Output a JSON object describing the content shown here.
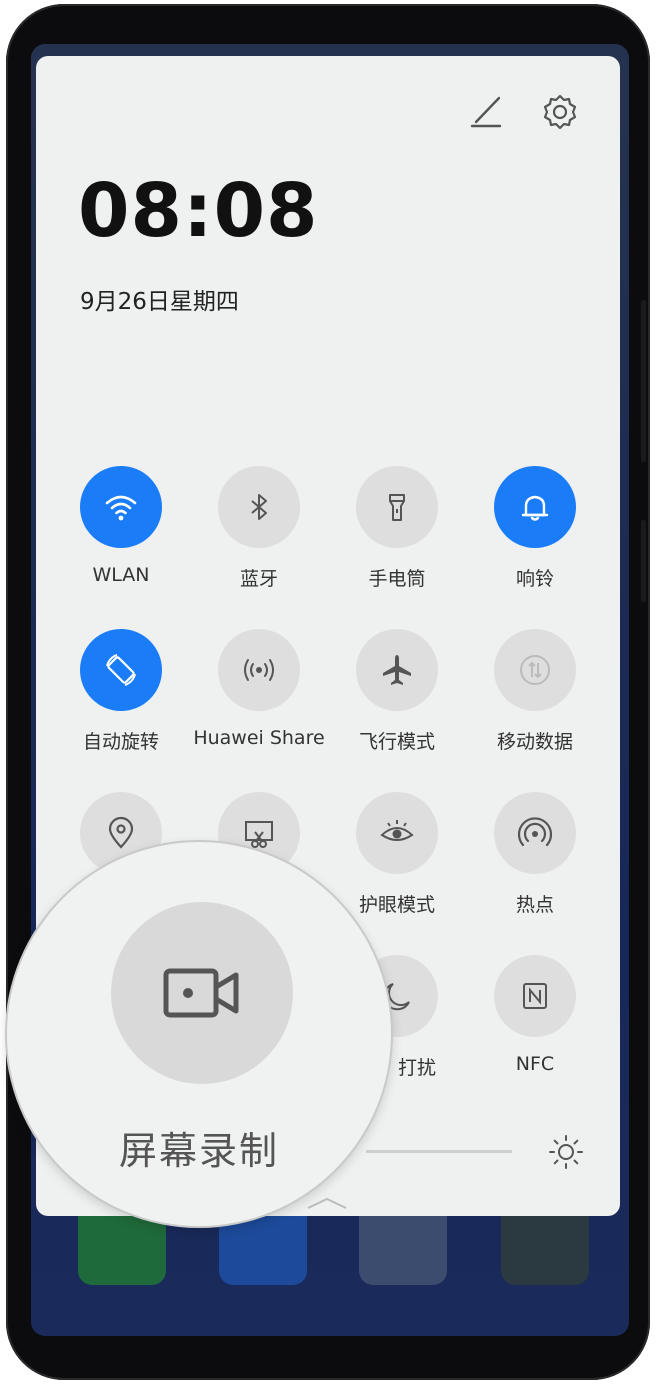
{
  "status": {
    "time": "08:08",
    "date": "9月26日星期四"
  },
  "header_icons": [
    "edit-icon",
    "settings-icon"
  ],
  "tiles": [
    {
      "label": "WLAN",
      "icon": "wifi-icon",
      "active": true
    },
    {
      "label": "蓝牙",
      "icon": "bluetooth-icon",
      "active": false
    },
    {
      "label": "手电筒",
      "icon": "flashlight-icon",
      "active": false
    },
    {
      "label": "响铃",
      "icon": "bell-icon",
      "active": true
    },
    {
      "label": "自动旋转",
      "icon": "auto-rotate-icon",
      "active": true
    },
    {
      "label": "Huawei Share",
      "icon": "huawei-share-icon",
      "active": false
    },
    {
      "label": "飞行模式",
      "icon": "airplane-icon",
      "active": false
    },
    {
      "label": "移动数据",
      "icon": "mobile-data-icon",
      "active": false
    },
    {
      "label": "",
      "icon": "location-icon",
      "active": false
    },
    {
      "label": "",
      "icon": "screenshot-icon",
      "active": false
    },
    {
      "label": "护眼模式",
      "icon": "eye-icon",
      "active": false
    },
    {
      "label": "热点",
      "icon": "hotspot-icon",
      "active": false
    },
    {
      "label": "打扰",
      "icon": "moon-icon",
      "active": false
    },
    {
      "label": "NFC",
      "icon": "nfc-icon",
      "active": false
    }
  ],
  "magnifier": {
    "label": "屏幕录制",
    "icon": "screen-record-icon"
  },
  "brightness": {
    "icon": "brightness-icon"
  },
  "colors": {
    "accent": "#1a7cf7",
    "panel": "#eff0f0",
    "tile_off": "#dedede"
  }
}
